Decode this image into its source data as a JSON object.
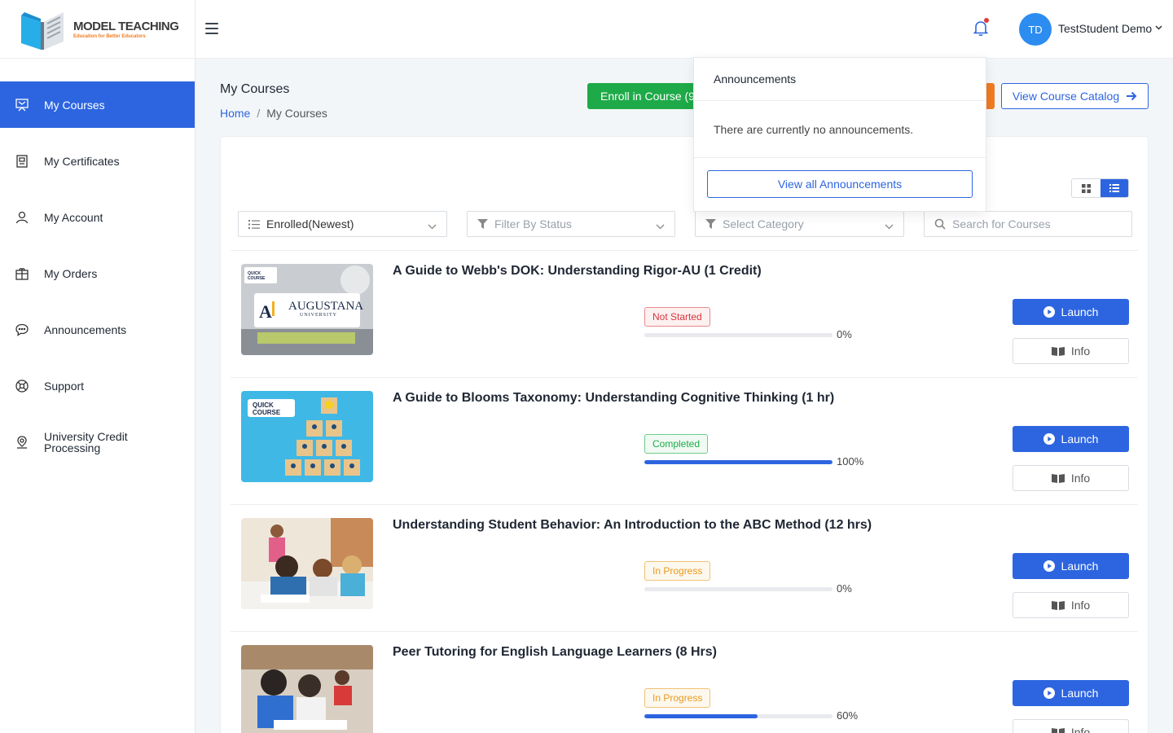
{
  "brand": {
    "title_a": "MODEL",
    "title_b": "TEACHING",
    "tagline": "Education for Better Educators"
  },
  "sidebar": {
    "items": [
      {
        "label": "My Courses",
        "icon": "courses-icon",
        "active": true
      },
      {
        "label": "My Certificates",
        "icon": "certificate-icon",
        "active": false
      },
      {
        "label": "My Account",
        "icon": "user-icon",
        "active": false
      },
      {
        "label": "My Orders",
        "icon": "orders-icon",
        "active": false
      },
      {
        "label": "Announcements",
        "icon": "chat-icon",
        "active": false
      },
      {
        "label": "Support",
        "icon": "support-icon",
        "active": false
      },
      {
        "label": "University Credit Processing",
        "icon": "location-icon",
        "active": false
      }
    ]
  },
  "header": {
    "user_initials": "TD",
    "user_name": "TestStudent Demo"
  },
  "page": {
    "title": "My Courses",
    "breadcrumb_home": "Home",
    "breadcrumb_current": "My Courses",
    "enroll_label": "Enroll in Course (9",
    "catalog_label": "View Course Catalog"
  },
  "filters": {
    "sort_value": "Enrolled(Newest)",
    "status_placeholder": "Filter By Status",
    "category_placeholder": "Select Category",
    "search_placeholder": "Search for Courses"
  },
  "courses": [
    {
      "title": "A Guide to Webb's DOK: Understanding Rigor-AU (1 Credit)",
      "status": "Not Started",
      "progress": 0,
      "progress_label": "0%",
      "thumb_text": "AUGUSTANA",
      "thumb_sub": "UNIVERSITY",
      "thumb_badge": "QUICK COURSE"
    },
    {
      "title": "A Guide to Blooms Taxonomy: Understanding Cognitive Thinking (1 hr)",
      "status": "Completed",
      "progress": 100,
      "progress_label": "100%",
      "thumb_badge": "QUICK COURSE"
    },
    {
      "title": "Understanding Student Behavior: An Introduction to the ABC Method (12 hrs)",
      "status": "In Progress",
      "progress": 0,
      "progress_label": "0%"
    },
    {
      "title": "Peer Tutoring for English Language Learners (8 Hrs)",
      "status": "In Progress",
      "progress": 60,
      "progress_label": "60%"
    }
  ],
  "course_actions": {
    "launch_label": "Launch",
    "info_label": "Info"
  },
  "announcements": {
    "header": "Announcements",
    "empty_text": "There are currently no announcements.",
    "view_all_label": "View all Announcements"
  },
  "colors": {
    "primary": "#2d65e0",
    "success": "#1eaa48",
    "warning": "#e89a19",
    "danger": "#d9363e",
    "accent": "#f07b22"
  }
}
